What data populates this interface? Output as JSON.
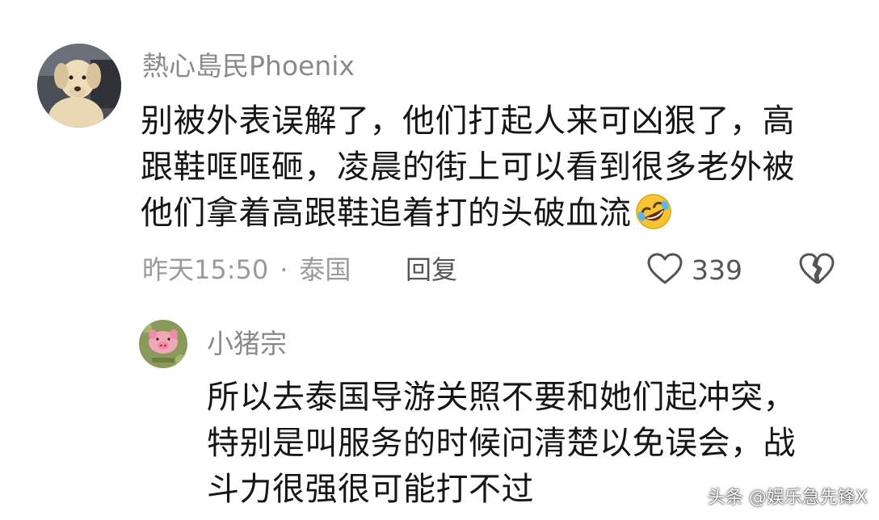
{
  "comment": {
    "username": "熱心島民Phoenix",
    "lines": [
      "别被外表误解了，他们打起人来可凶狠了，高",
      "跟鞋哐哐砸，凌晨的街上可以看到很多老外被",
      "他们拿着高跟鞋追着打的头破血流"
    ],
    "time": "昨天15:50",
    "separator": "·",
    "location": "泰国",
    "reply_label": "回复",
    "like_count": "339",
    "emoji": "rolling-on-floor-laughing-emoji"
  },
  "reply": {
    "username": "小猪宗",
    "lines": [
      "所以去泰国导游关照不要和她们起冲突，",
      "特别是叫服务的时候问清楚以免误会，战",
      "斗力很强很可能打不过"
    ]
  },
  "watermark": "头条 @娱乐急先锋X",
  "colors": {
    "username": "#8a8a8a",
    "text": "#161616",
    "meta": "#9a9a9a",
    "action": "#555555"
  }
}
